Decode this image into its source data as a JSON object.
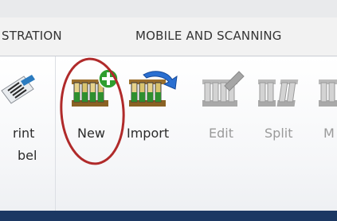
{
  "tabs": [
    {
      "label": "STRATION"
    },
    {
      "label": "MOBILE AND SCANNING"
    }
  ],
  "buttons": {
    "print_label": {
      "line1": "rint",
      "line2": "bel"
    },
    "new": "New",
    "import": "Import",
    "edit": "Edit",
    "split": "Split",
    "more": "M"
  },
  "colors": {
    "bottom_bar": "#1c3863",
    "annotation": "#b02a2a",
    "add_badge": "#2f9e2f"
  },
  "icons": {
    "print_label": "barcode-icon",
    "new": "tube-rack-add-icon",
    "import": "tube-rack-import-icon",
    "edit": "tube-rack-edit-icon",
    "split": "tube-rack-split-icon",
    "more": "tube-rack-icon"
  }
}
